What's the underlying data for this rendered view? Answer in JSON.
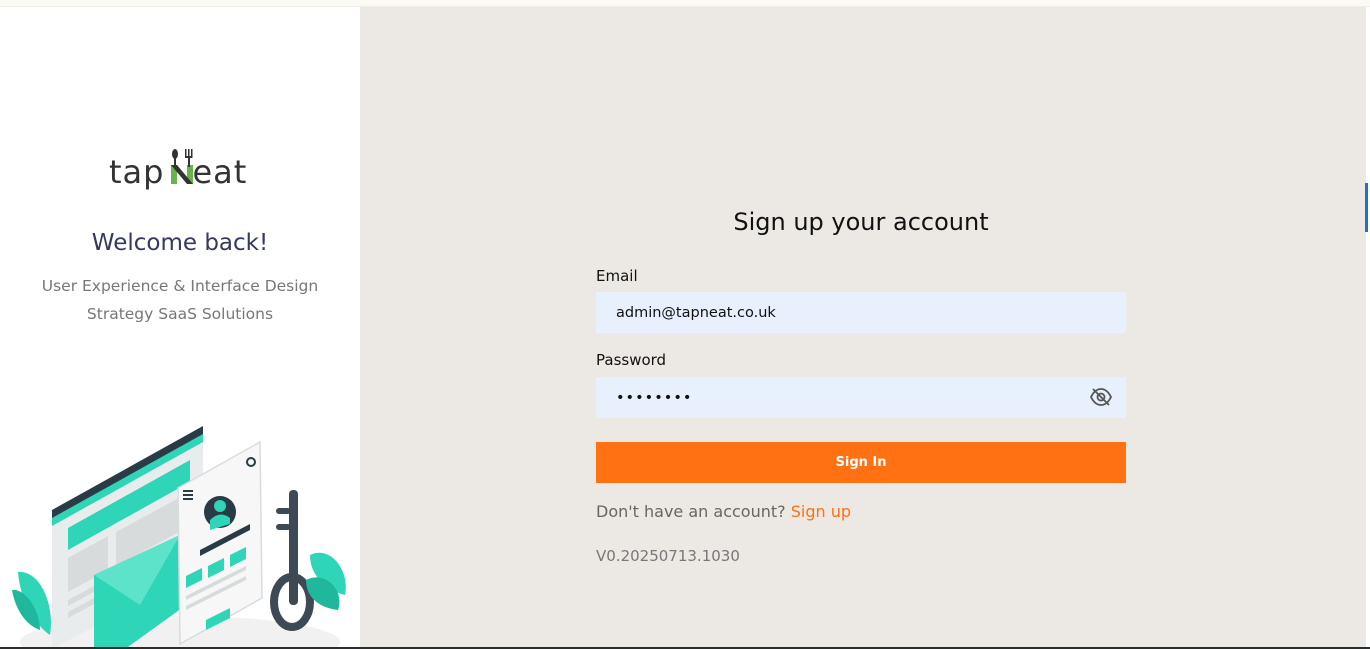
{
  "brand": {
    "name_left": "tap",
    "name_right": "eat",
    "logo_icon": "fork-spoon-n-logo",
    "accent_green": "#6ab24c",
    "accent_orange": "#ff7112"
  },
  "left": {
    "welcome": "Welcome back!",
    "tagline_line1": "User Experience & Interface Design",
    "tagline_line2": "Strategy SaaS Solutions",
    "illustration": "login-security-illustration"
  },
  "form": {
    "title": "Sign up your account",
    "email_label": "Email",
    "email_value": "admin@tapneat.co.uk",
    "password_label": "Password",
    "password_value": "••••••••",
    "toggle_icon": "eye-slash-icon",
    "submit_label": "Sign In",
    "no_account_text": "Don't have an account?",
    "signup_link": "Sign up",
    "version": "V0.20250713.1030"
  }
}
